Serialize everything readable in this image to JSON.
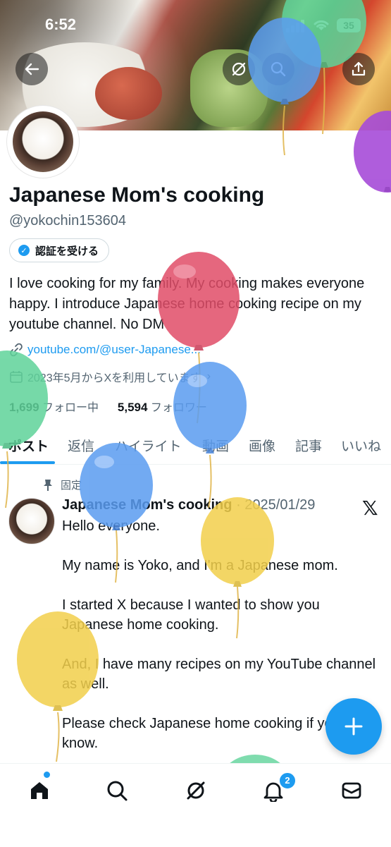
{
  "status_bar": {
    "time": "6:52",
    "battery": "35"
  },
  "profile": {
    "display_name": "Japanese Mom's cooking",
    "handle": "@yokochin153604",
    "verify_button": "認証を受ける",
    "bio": "I love cooking for my family. My cooking makes everyone happy. I introduce Japanese home cooking recipe on my youtube channel. No DM",
    "link": "youtube.com/@user-Japanese...",
    "joined": "2023年5月からXを利用しています",
    "following_count": "1,699",
    "following_label": "フォロー中",
    "followers_count": "5,594",
    "followers_label": "フォロワー"
  },
  "tabs": [
    "ポスト",
    "返信",
    "ハイライト",
    "動画",
    "画像",
    "記事",
    "いいね"
  ],
  "pinned_post": {
    "pinned_label": "固定",
    "author": "Japanese Mom's cooking",
    "date": "· 2025/01/29",
    "text": "Hello everyone.\n\nMy name is Yoko, and I'm a Japanese mom.\n\nI started X because I wanted to show you Japanese home cooking.\n\nAnd, I have many recipes on my YouTube channel as well.\n\nPlease check Japanese home cooking if you don't know."
  },
  "icons": {
    "back": "arrow-left-icon",
    "grok": "slash-circle-icon",
    "search": "search-icon",
    "share": "share-icon",
    "link": "link-icon",
    "calendar": "calendar-icon",
    "pin": "pin-icon",
    "compose": "plus-icon"
  },
  "nav": {
    "notifications_badge": "2"
  },
  "colors": {
    "accent": "#1d9bf0",
    "text": "#0f1419",
    "secondary": "#536471"
  }
}
